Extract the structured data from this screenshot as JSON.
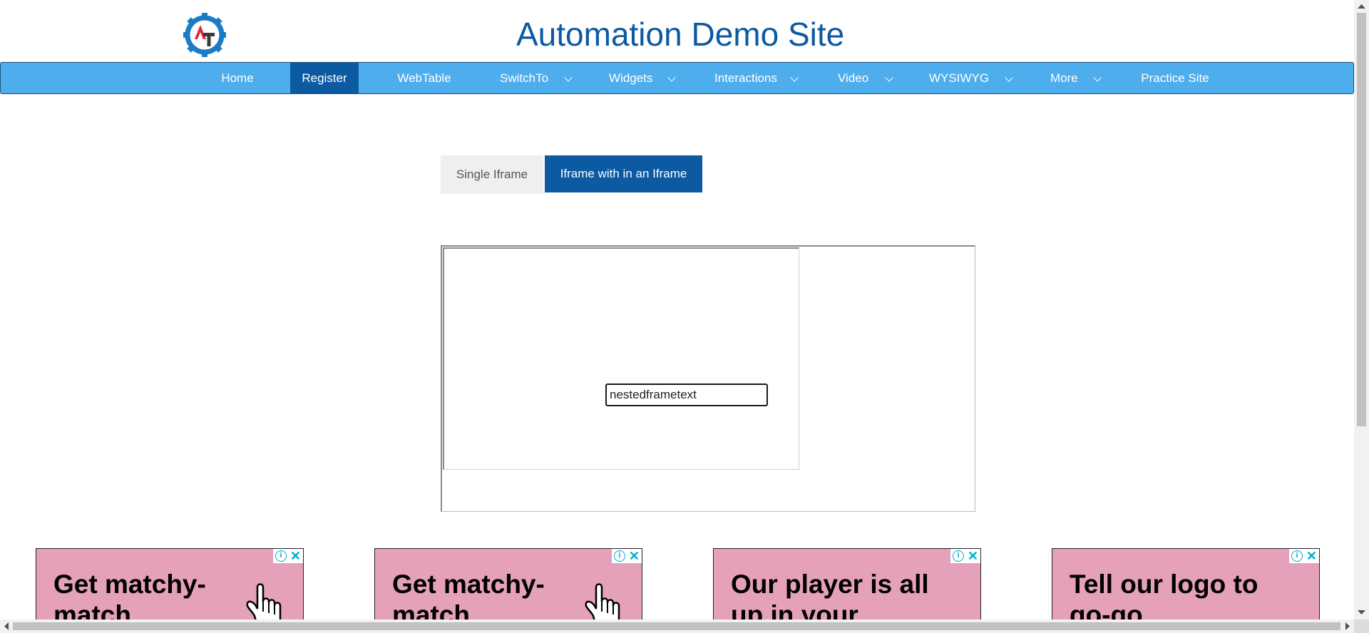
{
  "site": {
    "title": "Automation Demo Site",
    "logo": "automation-testing-gear-logo"
  },
  "navbar": {
    "items": [
      {
        "label": "Home",
        "dropdown": false
      },
      {
        "label": "Register",
        "dropdown": false,
        "active": true
      },
      {
        "label": "WebTable",
        "dropdown": false
      },
      {
        "label": "SwitchTo",
        "dropdown": true
      },
      {
        "label": "Widgets",
        "dropdown": true
      },
      {
        "label": "Interactions",
        "dropdown": true
      },
      {
        "label": "Video",
        "dropdown": true
      },
      {
        "label": "WYSIWYG",
        "dropdown": true
      },
      {
        "label": "More",
        "dropdown": true
      },
      {
        "label": "Practice Site",
        "dropdown": false
      }
    ]
  },
  "tabs": [
    {
      "label": "Single Iframe",
      "active": false
    },
    {
      "label": "Iframe with in an Iframe",
      "active": true
    }
  ],
  "nested_frame": {
    "input_value": "nestedframetext"
  },
  "ads": [
    {
      "text": "Get matchy-match"
    },
    {
      "text": "Get matchy-match"
    },
    {
      "text": "Our player is all up in your"
    },
    {
      "text": "Tell our logo to go-go"
    }
  ],
  "ad_controls": {
    "info_glyph": "i",
    "close_glyph": "✕"
  },
  "colors": {
    "accent": "#0b5aa2",
    "navbar": "#4eaded",
    "ad_bg": "#e5a1b9",
    "ad_icon": "#00aecd"
  }
}
